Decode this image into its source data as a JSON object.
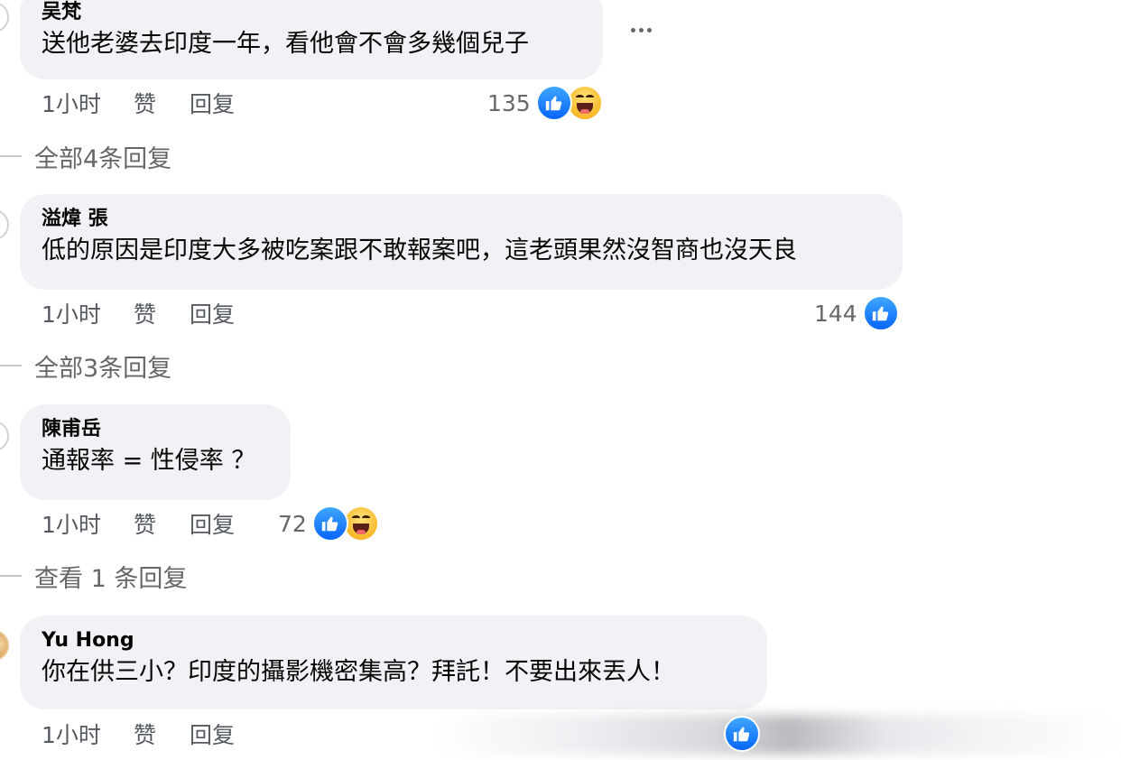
{
  "comments": [
    {
      "author": "吴梵",
      "text": "送他老婆去印度一年，看他會不會多幾個兒子",
      "time": "1小时",
      "like_label": "赞",
      "reply_label": "回复",
      "reaction_count": "135",
      "reactions": [
        "like-icon",
        "haha-icon"
      ],
      "replies_label": "全部4条回复"
    },
    {
      "author": "溢煒 張",
      "text": "低的原因是印度大多被吃案跟不敢報案吧，這老頭果然沒智商也沒天良",
      "time": "1小时",
      "like_label": "赞",
      "reply_label": "回复",
      "reaction_count": "144",
      "reactions": [
        "like-icon"
      ],
      "replies_label": "全部3条回复"
    },
    {
      "author": "陳甫岳",
      "text": "通報率 = 性侵率 ？",
      "time": "1小时",
      "like_label": "赞",
      "reply_label": "回复",
      "reaction_count": "72",
      "reactions": [
        "like-icon",
        "haha-icon"
      ],
      "replies_label": "查看 1 条回复"
    },
    {
      "author": "Yu Hong",
      "text": "你在供三小？印度的攝影機密集高？拜託！不要出來丟人！",
      "time": "1小时",
      "like_label": "赞",
      "reply_label": "回复",
      "reactions": [
        "like-icon"
      ]
    }
  ],
  "colors": {
    "bubble_bg": "#f0f2f5",
    "text_primary": "#050505",
    "text_secondary": "#65676b",
    "like_blue": "#0866ff",
    "haha_yellow": "#f7b928"
  },
  "icons": {
    "more": "more-options-icon",
    "like": "like-icon",
    "haha": "haha-icon"
  }
}
